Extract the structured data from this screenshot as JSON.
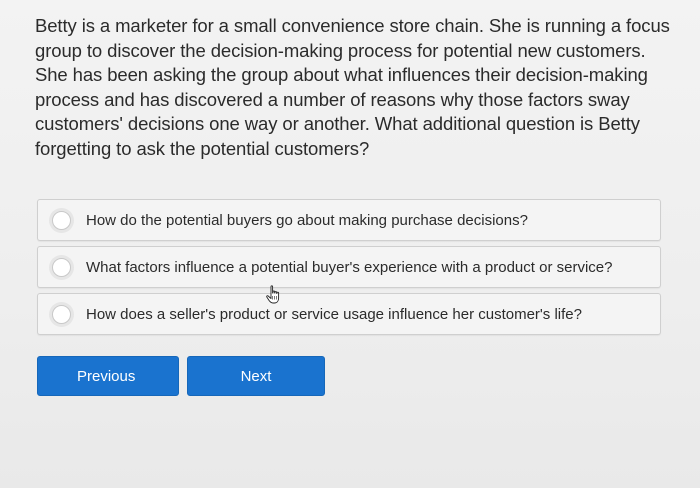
{
  "question": {
    "text": "Betty is a marketer for a small convenience store chain. She is running a focus group to discover the decision-making process for potential new customers. She has been asking the group about what influences their decision-making process and has discovered a number of reasons why those factors sway customers' decisions one way or another. What additional question is Betty forgetting to ask the potential customers?"
  },
  "options": [
    {
      "label": "How do the potential buyers go about making purchase decisions?",
      "selected": false
    },
    {
      "label": "What factors influence a potential buyer's experience with a product or service?",
      "selected": false
    },
    {
      "label": "How does a seller's product or service usage influence her customer's life?",
      "selected": false
    }
  ],
  "buttons": {
    "previous_label": "Previous",
    "next_label": "Next"
  },
  "colors": {
    "button_blue": "#1a73cf",
    "background": "#efefef"
  },
  "icons": {
    "cursor": "hand-pointer-icon"
  }
}
